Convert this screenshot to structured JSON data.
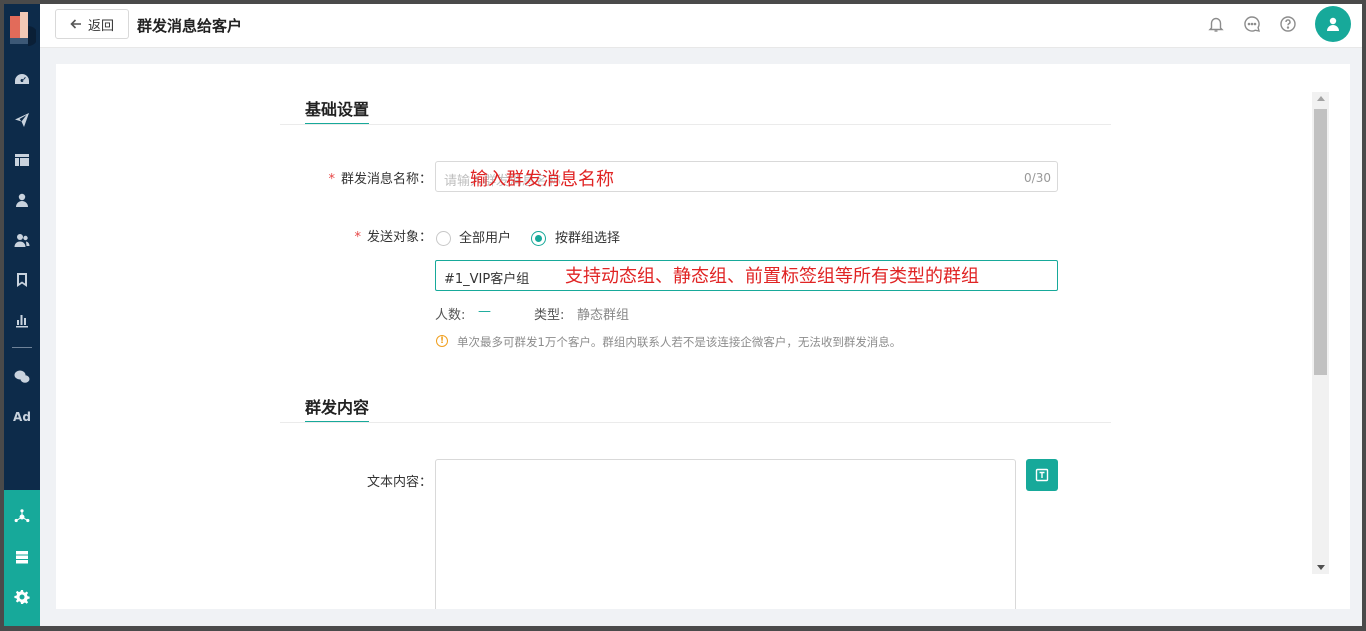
{
  "header": {
    "back_label": "返回",
    "title": "群发消息给客户"
  },
  "sidebar": {
    "ad_label": "Ad"
  },
  "basic": {
    "section_title": "基础设置",
    "name_label": "群发消息名称：",
    "name_placeholder": "请输入群发消息名称",
    "name_counter": "0/30",
    "name_annotation": "输入群发消息名称",
    "target_label": "发送对象：",
    "radio_all": "全部用户",
    "radio_group": "按群组选择",
    "group_value": "#1_VIP客户组",
    "group_annotation": "支持动态组、静态组、前置标签组等所有类型的群组",
    "count_label": "人数:",
    "count_value": "—",
    "type_label": "类型:",
    "type_value": "静态群组",
    "tip": "单次最多可群发1万个客户。群组内联系人若不是该连接企微客户，无法收到群发消息。"
  },
  "content": {
    "section_title": "群发内容",
    "text_label": "文本内容："
  },
  "colors": {
    "accent": "#17a99a",
    "sidebar_bg": "#0d2b4a",
    "annotation": "#e02424"
  }
}
